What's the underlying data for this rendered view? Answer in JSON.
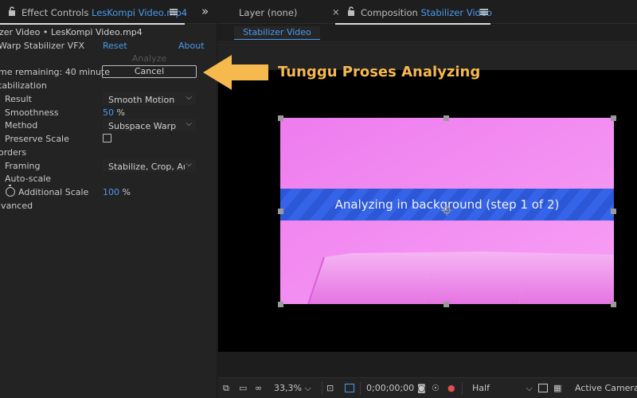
{
  "effect_controls": {
    "tab_label": "Effect Controls",
    "tab_file": "LesKompi Video.mp4",
    "layer_path": "zer Video • LesKompi Video.mp4",
    "effect_name": "Warp Stabilizer VFX",
    "reset_label": "Reset",
    "about_label": "About",
    "analyze_label": "Analyze",
    "time_remaining": "me remaining: 40 minute",
    "cancel_label": "Cancel",
    "section_stabilization": "tabilization",
    "result_label": "Result",
    "result_value": "Smooth Motion",
    "smoothness_label": "Smoothness",
    "smoothness_value": "50",
    "smoothness_unit": "%",
    "method_label": "Method",
    "method_value": "Subspace Warp",
    "preserve_scale_label": "Preserve Scale",
    "preserve_scale_checked": false,
    "section_borders": "orders",
    "framing_label": "Framing",
    "framing_value": "Stabilize, Crop, Auto",
    "autoscale_label": "Auto-scale",
    "additional_scale_label": "Additional Scale",
    "additional_scale_value": "100",
    "additional_scale_unit": "%",
    "section_advanced": "lvanced"
  },
  "annotation": {
    "text": "Tunggu Proses Analyzing",
    "color": "#f6b94e"
  },
  "viewer_tabs": {
    "layer_tab": "Layer (none)",
    "composition_prefix": "Composition",
    "composition_name": "Stabilizer Video",
    "subtab": "Stabilizer Video"
  },
  "viewer": {
    "banner_text": "Analyzing in background (step 1 of 2)",
    "banner_color": "#2f5fe0",
    "frame_color": "#f27cf2"
  },
  "toolbar": {
    "zoom": "33,3%",
    "timecode": "0;00;00;00",
    "resolution": "Half",
    "camera": "Active Camera"
  },
  "colors": {
    "accent_blue": "#4a9bef"
  }
}
